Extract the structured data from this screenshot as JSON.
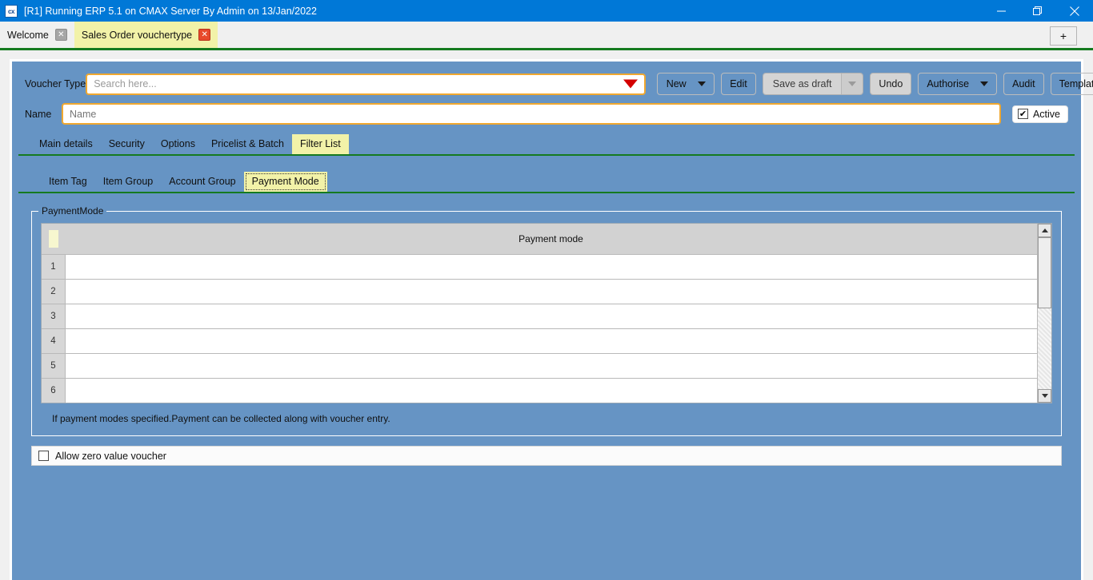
{
  "window": {
    "title": "[R1] Running ERP 5.1 on CMAX Server By Admin on 13/Jan/2022",
    "app_icon_text": "cx",
    "minimize_label": "Minimize",
    "restore_label": "Restore",
    "close_label": "Close"
  },
  "tabstrip": {
    "tabs": [
      {
        "label": "Welcome",
        "close": "✕",
        "active": false
      },
      {
        "label": "Sales Order vouchertype",
        "close": "✕",
        "active": true
      }
    ],
    "new_tab_label": "+"
  },
  "form": {
    "voucher_type_label": "Voucher Type",
    "voucher_type_value": "",
    "voucher_type_placeholder": "Search here...",
    "name_label": "Name",
    "name_value": "",
    "name_placeholder": "Name",
    "active_label": "Active",
    "active_checked": true,
    "active_mark": "✔"
  },
  "toolbar": {
    "new_label": "New",
    "edit_label": "Edit",
    "save_as_draft_label": "Save as draft",
    "undo_label": "Undo",
    "authorise_label": "Authorise",
    "audit_label": "Audit",
    "template_label": "Template"
  },
  "main_tabs": [
    {
      "label": "Main details",
      "selected": false
    },
    {
      "label": "Security",
      "selected": false
    },
    {
      "label": "Options",
      "selected": false
    },
    {
      "label": "Pricelist & Batch",
      "selected": false
    },
    {
      "label": "Filter List",
      "selected": true
    }
  ],
  "sub_tabs": [
    {
      "label": "Item Tag",
      "selected": false
    },
    {
      "label": "Item Group",
      "selected": false
    },
    {
      "label": "Account Group",
      "selected": false
    },
    {
      "label": "Payment Mode",
      "selected": true
    }
  ],
  "groupbox": {
    "title": "PaymentMode",
    "hint": "If payment modes specified.Payment can be collected along with voucher entry."
  },
  "grid": {
    "columns": [
      "Payment mode"
    ],
    "rows": [
      {
        "num": "1",
        "payment_mode": ""
      },
      {
        "num": "2",
        "payment_mode": ""
      },
      {
        "num": "3",
        "payment_mode": ""
      },
      {
        "num": "4",
        "payment_mode": ""
      },
      {
        "num": "5",
        "payment_mode": ""
      },
      {
        "num": "6",
        "payment_mode": ""
      }
    ]
  },
  "bottom": {
    "allow_zero_label": "Allow zero value voucher",
    "allow_zero_checked": false
  },
  "colors": {
    "titlebar": "#0078d7",
    "form_background": "#6694c4",
    "accent_tab": "#f2f2a8",
    "separator_green": "#157a1f",
    "field_border": "#f0a830",
    "dropdown_arrow_red": "#d40000"
  }
}
